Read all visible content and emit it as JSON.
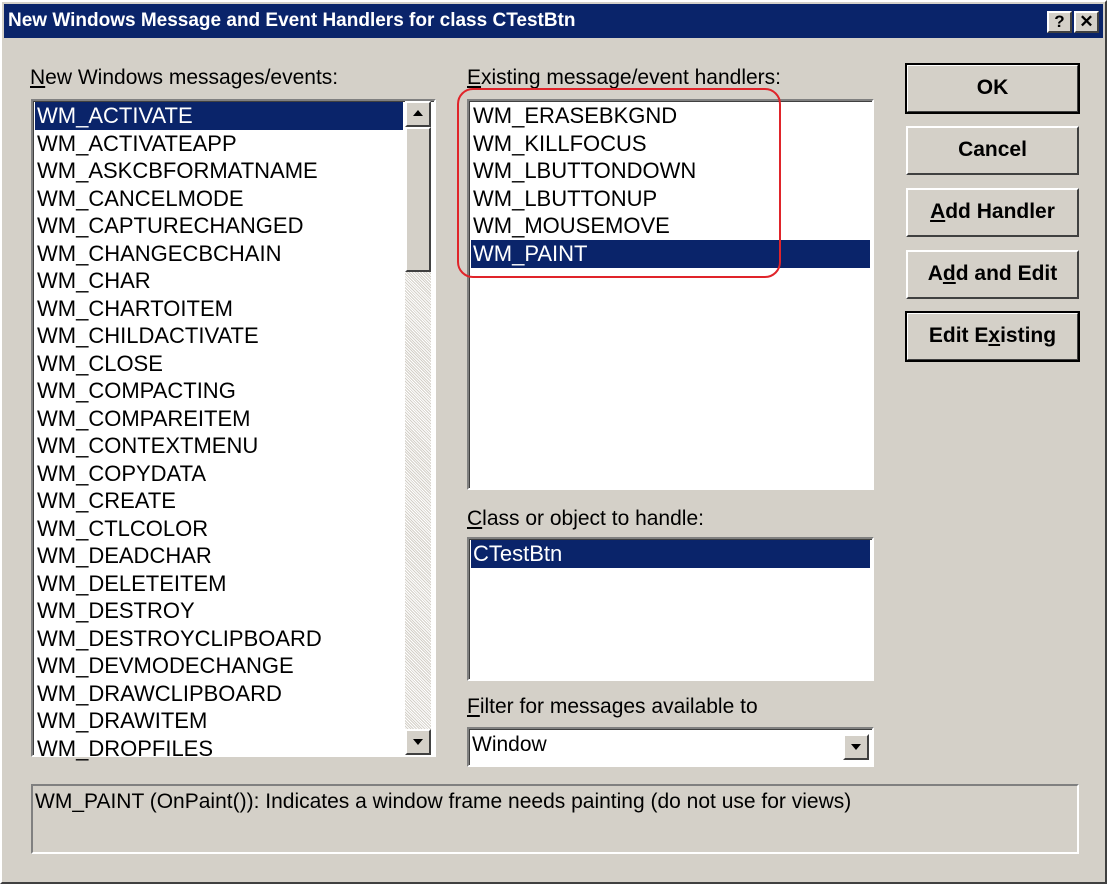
{
  "window": {
    "title": "New Windows Message and Event Handlers for class CTestBtn",
    "help_button": "?",
    "close_button": "✕"
  },
  "messages": {
    "label_mnemonic": "N",
    "label_rest": "ew Windows messages/events:",
    "items": [
      "WM_ACTIVATE",
      "WM_ACTIVATEAPP",
      "WM_ASKCBFORMATNAME",
      "WM_CANCELMODE",
      "WM_CAPTURECHANGED",
      "WM_CHANGECBCHAIN",
      "WM_CHAR",
      "WM_CHARTOITEM",
      "WM_CHILDACTIVATE",
      "WM_CLOSE",
      "WM_COMPACTING",
      "WM_COMPAREITEM",
      "WM_CONTEXTMENU",
      "WM_COPYDATA",
      "WM_CREATE",
      "WM_CTLCOLOR",
      "WM_DEADCHAR",
      "WM_DELETEITEM",
      "WM_DESTROY",
      "WM_DESTROYCLIPBOARD",
      "WM_DEVMODECHANGE",
      "WM_DRAWCLIPBOARD",
      "WM_DRAWITEM",
      "WM_DROPFILES"
    ],
    "selected": "WM_ACTIVATE"
  },
  "handlers": {
    "label_mnemonic": "E",
    "label_rest": "xisting message/event handlers:",
    "items": [
      "WM_ERASEBKGND",
      "WM_KILLFOCUS",
      "WM_LBUTTONDOWN",
      "WM_LBUTTONUP",
      "WM_MOUSEMOVE",
      "WM_PAINT"
    ],
    "selected": "WM_PAINT"
  },
  "class_object": {
    "label_mnemonic": "C",
    "label_rest": "lass or object to handle:",
    "items": [
      "CTestBtn"
    ],
    "selected": "CTestBtn"
  },
  "filter": {
    "label_mnemonic": "F",
    "label_rest": "ilter for messages available to",
    "value": "Window"
  },
  "buttons": {
    "ok": "OK",
    "cancel": "Cancel",
    "add_handler_mnemonic": "A",
    "add_handler_rest": "dd Handler",
    "add_edit_pre": "A",
    "add_edit_mnemonic": "d",
    "add_edit_rest": "d and Edit",
    "edit_existing_pre": "Edit E",
    "edit_existing_mnemonic": "x",
    "edit_existing_rest": "isting"
  },
  "description": "WM_PAINT (OnPaint()):  Indicates a window frame needs painting (do not use for views)",
  "colors": {
    "selection": "#0a246a",
    "face": "#d4d0c8",
    "annotation": "#e0242a"
  }
}
